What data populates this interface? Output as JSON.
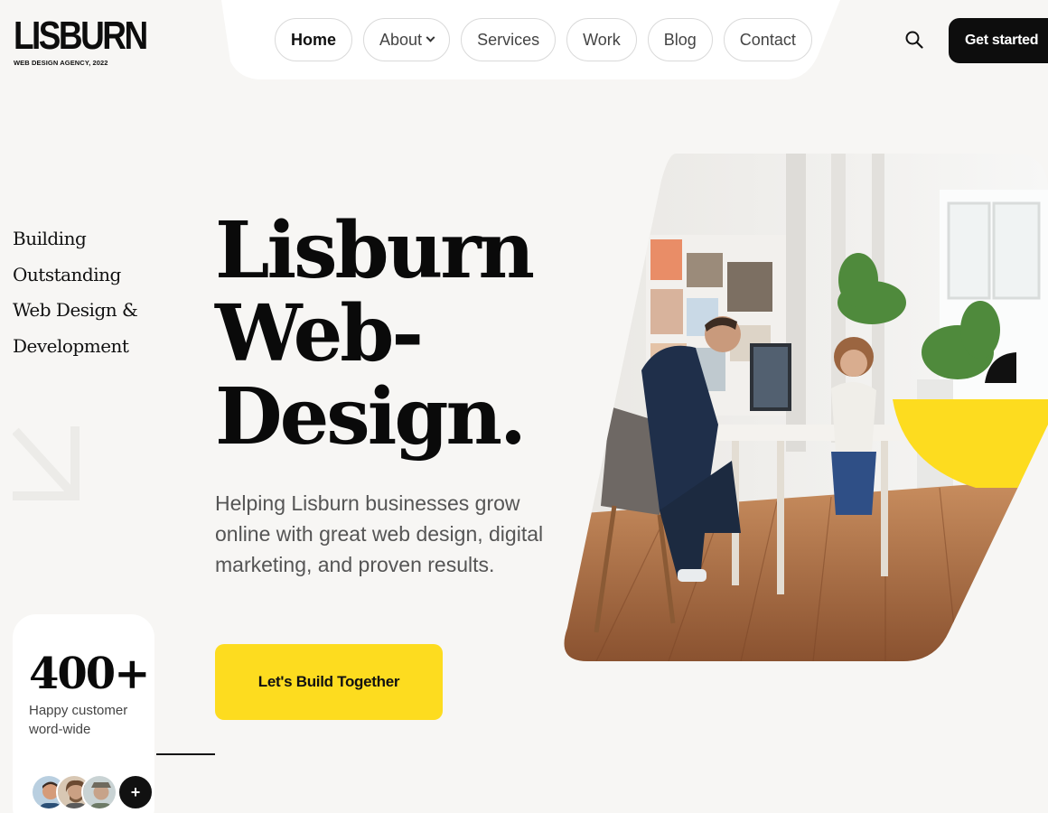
{
  "brand": {
    "name": "LISBURN",
    "subtitle": "WEB DESIGN AGENCY, 2022"
  },
  "nav": {
    "items": [
      {
        "label": "Home"
      },
      {
        "label": "About"
      },
      {
        "label": "Services"
      },
      {
        "label": "Work"
      },
      {
        "label": "Blog"
      },
      {
        "label": "Contact"
      }
    ],
    "active": "Home",
    "cta_label": "Get started"
  },
  "hero": {
    "tagline_lines": [
      "Building",
      "Outstanding",
      "Web Design &",
      "Development"
    ],
    "headline_lines": [
      "Lisburn",
      "Web-",
      "Design."
    ],
    "subtext": "Helping Lisburn businesses grow online with great web design, digital marketing, and proven results.",
    "cta_label": "Let's Build Together"
  },
  "stats": {
    "number": "400+",
    "label": "Happy customer word-wide",
    "more_label": "+"
  },
  "colors": {
    "accent": "#fddc1f",
    "dark": "#0d0d0d",
    "background": "#f7f6f4"
  },
  "icons": {
    "search": "search-icon",
    "arrow": "arrow-down-right-icon",
    "chevron": "chevron-down-icon"
  }
}
